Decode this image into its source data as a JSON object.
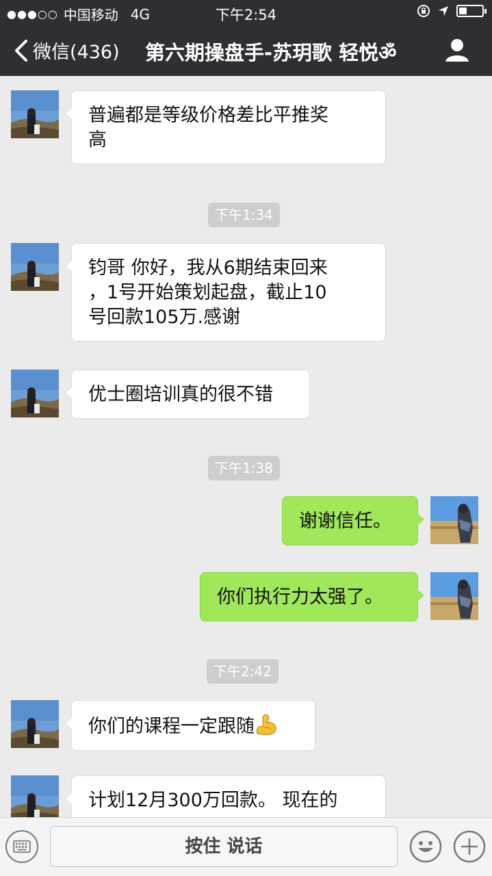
{
  "status_bar": {
    "signal": "●●●○○",
    "carrier": "中国移动",
    "network": "4G",
    "time": "下午2:54",
    "battery_level": 0.35
  },
  "nav": {
    "back_label": "微信(436)",
    "title": "第六期操盘手-苏玥歌 轻悦ॐ",
    "icons": [
      "chevron-left-icon",
      "user-profile-icon"
    ]
  },
  "messages": [
    {
      "side": "left",
      "text_lines": [
        "普遍都是等级价格差比平推奖",
        "高"
      ]
    },
    {
      "type": "time",
      "text": "下午1:34"
    },
    {
      "side": "left",
      "text_lines": [
        "钧哥 你好，我从6期结束回来",
        "，1号开始策划起盘，截止10",
        "号回款105万.感谢"
      ]
    },
    {
      "side": "left",
      "text_lines": [
        "优士圈培训真的很不错"
      ]
    },
    {
      "type": "time",
      "text": "下午1:38"
    },
    {
      "side": "right",
      "text_lines": [
        "谢谢信任。"
      ]
    },
    {
      "side": "right",
      "text_lines": [
        "你们执行力太强了。"
      ]
    },
    {
      "type": "time",
      "text": "下午2:42"
    },
    {
      "side": "left",
      "text_lines": [
        "你们的课程一定跟随"
      ],
      "emoji": "flexed-biceps-icon"
    },
    {
      "side": "left",
      "text_lines": [
        "计划12月300万回款。 现在的"
      ]
    }
  ],
  "input_bar": {
    "hold_to_talk": "按住 说话",
    "icons": [
      "keyboard-icon",
      "emoji-icon",
      "plus-icon"
    ]
  },
  "colors": {
    "header_bg": "#2e2e33",
    "chat_bg": "#ebebeb",
    "sent_bubble": "#a0e75a",
    "received_bubble": "#ffffff",
    "timestamp_bg": "#cecece"
  }
}
